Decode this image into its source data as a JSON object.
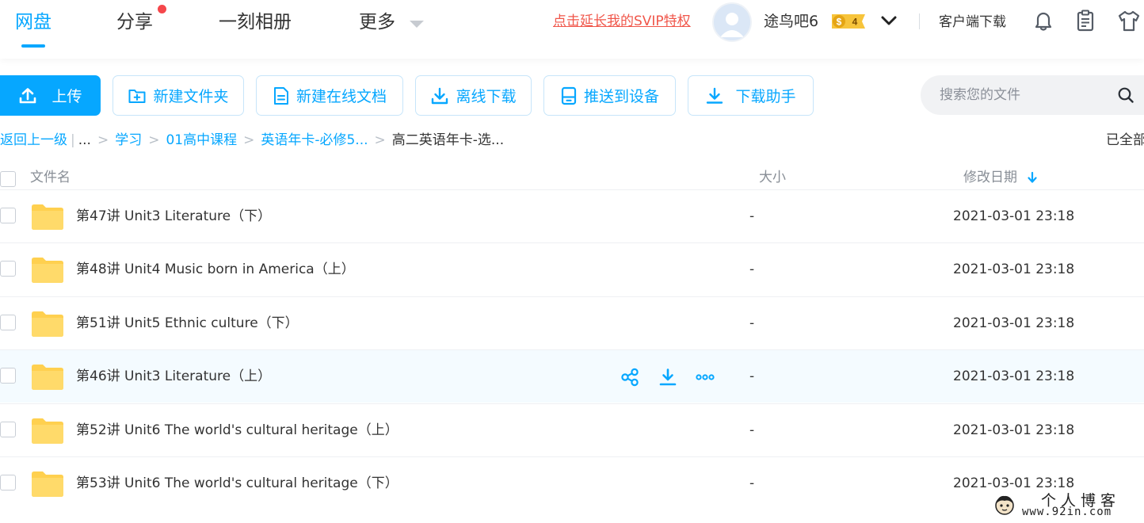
{
  "colors": {
    "accent": "#06a7ff",
    "alert": "#f0564a",
    "folder": "#ffd04f",
    "row_hover": "#f4fbff"
  },
  "nav": {
    "tabs": [
      "网盘",
      "分享",
      "一刻相册",
      "更多"
    ],
    "active_tab": "网盘",
    "share_has_notification": true,
    "svip_link": "点击延长我的SVIP特权",
    "username": "途鸟吧6",
    "vip_level": "4",
    "vip_symbol": "$",
    "client_download": "客户端下载",
    "icons": [
      "bell-icon",
      "clipboard-icon",
      "shirt-icon"
    ]
  },
  "toolbar": {
    "upload": "上传",
    "new_folder": "新建文件夹",
    "new_online_doc": "新建在线文档",
    "offline_download": "离线下载",
    "push_to_device": "推送到设备",
    "download_helper": "下载助手"
  },
  "search": {
    "placeholder": "搜索您的文件",
    "value": ""
  },
  "breadcrumb": {
    "back": "返回上一级",
    "pipe": "|",
    "ellipsis": "...",
    "separator": ">",
    "items": [
      "学习",
      "01高中课程",
      "英语年卡-必修5..."
    ],
    "current": "高二英语年卡-选...",
    "loaded_status": "已全部"
  },
  "table": {
    "columns": {
      "name": "文件名",
      "size": "大小",
      "modified": "修改日期"
    },
    "sort": "modified-desc",
    "rows": [
      {
        "name": "第47讲 Unit3 Literature（下）",
        "size": "-",
        "date": "2021-03-01 23:18"
      },
      {
        "name": "第48讲 Unit4 Music born in America（上）",
        "size": "-",
        "date": "2021-03-01 23:18"
      },
      {
        "name": "第51讲 Unit5 Ethnic culture（下）",
        "size": "-",
        "date": "2021-03-01 23:18"
      },
      {
        "name": "第46讲 Unit3 Literature（上）",
        "size": "-",
        "date": "2021-03-01 23:18"
      },
      {
        "name": "第52讲 Unit6 The world's cultural heritage（上）",
        "size": "-",
        "date": "2021-03-01 23:18"
      },
      {
        "name": "第53讲 Unit6 The world's cultural heritage（下）",
        "size": "-",
        "date": "2021-03-01 23:18"
      }
    ],
    "hovered_row": 3,
    "row_action_icons": [
      "share-icon",
      "download-icon",
      "more-icon"
    ]
  },
  "watermark": {
    "title": "个人博客",
    "url": "www.92in.com"
  }
}
